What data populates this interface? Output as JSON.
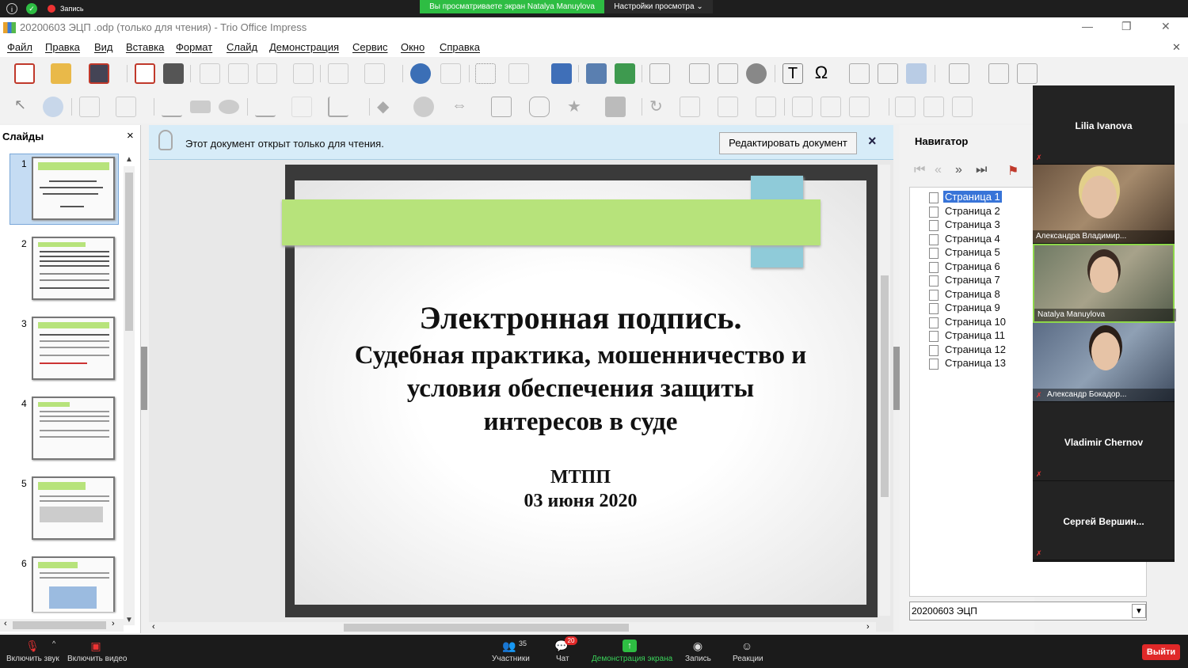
{
  "zoom_top": {
    "recording": "Запись",
    "share_banner": "Вы просматриваете экран Natalya Manuylova",
    "view_settings": "Настройки просмотра ⌄"
  },
  "window": {
    "title": "20200603 ЭЦП .odp (только для чтения) - Trio Office Impress"
  },
  "menu": [
    "Файл",
    "Правка",
    "Вид",
    "Вставка",
    "Формат",
    "Слайд",
    "Демонстрация",
    "Сервис",
    "Окно",
    "Справка"
  ],
  "slides_panel": {
    "title": "Слайды",
    "close": "×",
    "numbers": [
      "1",
      "2",
      "3",
      "4",
      "5",
      "6"
    ]
  },
  "infobar": {
    "message": "Этот документ открыт только для чтения.",
    "edit_button": "Редактировать документ",
    "close": "×"
  },
  "slide": {
    "title": "Электронная подпись.",
    "subtitle_1": "Судебная практика, мошенничество и",
    "subtitle_2": "условия обеспечения защиты",
    "subtitle_3": "интересов в суде",
    "org": "МТПП",
    "date": "03 июня 2020"
  },
  "navigator": {
    "title": "Навигатор",
    "pages": [
      "Страница 1",
      "Страница 2",
      "Страница 3",
      "Страница 4",
      "Страница 5",
      "Страница 6",
      "Страница 7",
      "Страница 8",
      "Страница 9",
      "Страница 10",
      "Страница 11",
      "Страница 12",
      "Страница 13"
    ],
    "document": "20200603 ЭЦП"
  },
  "participants": [
    {
      "name": "Lilia Ivanova"
    },
    {
      "name": "Александра Владимир..."
    },
    {
      "name": "Natalya Manuylova"
    },
    {
      "name": "Александр Бокадор..."
    },
    {
      "name": "Vladimir Chernov"
    },
    {
      "name": "Сергей  Вершин..."
    }
  ],
  "zoom_bottom": {
    "unmute": "Включить звук",
    "start_video": "Включить видео",
    "participants": "Участники",
    "participants_count": "35",
    "chat": "Чат",
    "chat_badge": "20",
    "share": "Демонстрация экрана",
    "record": "Запись",
    "reactions": "Реакции",
    "leave": "Выйти"
  }
}
